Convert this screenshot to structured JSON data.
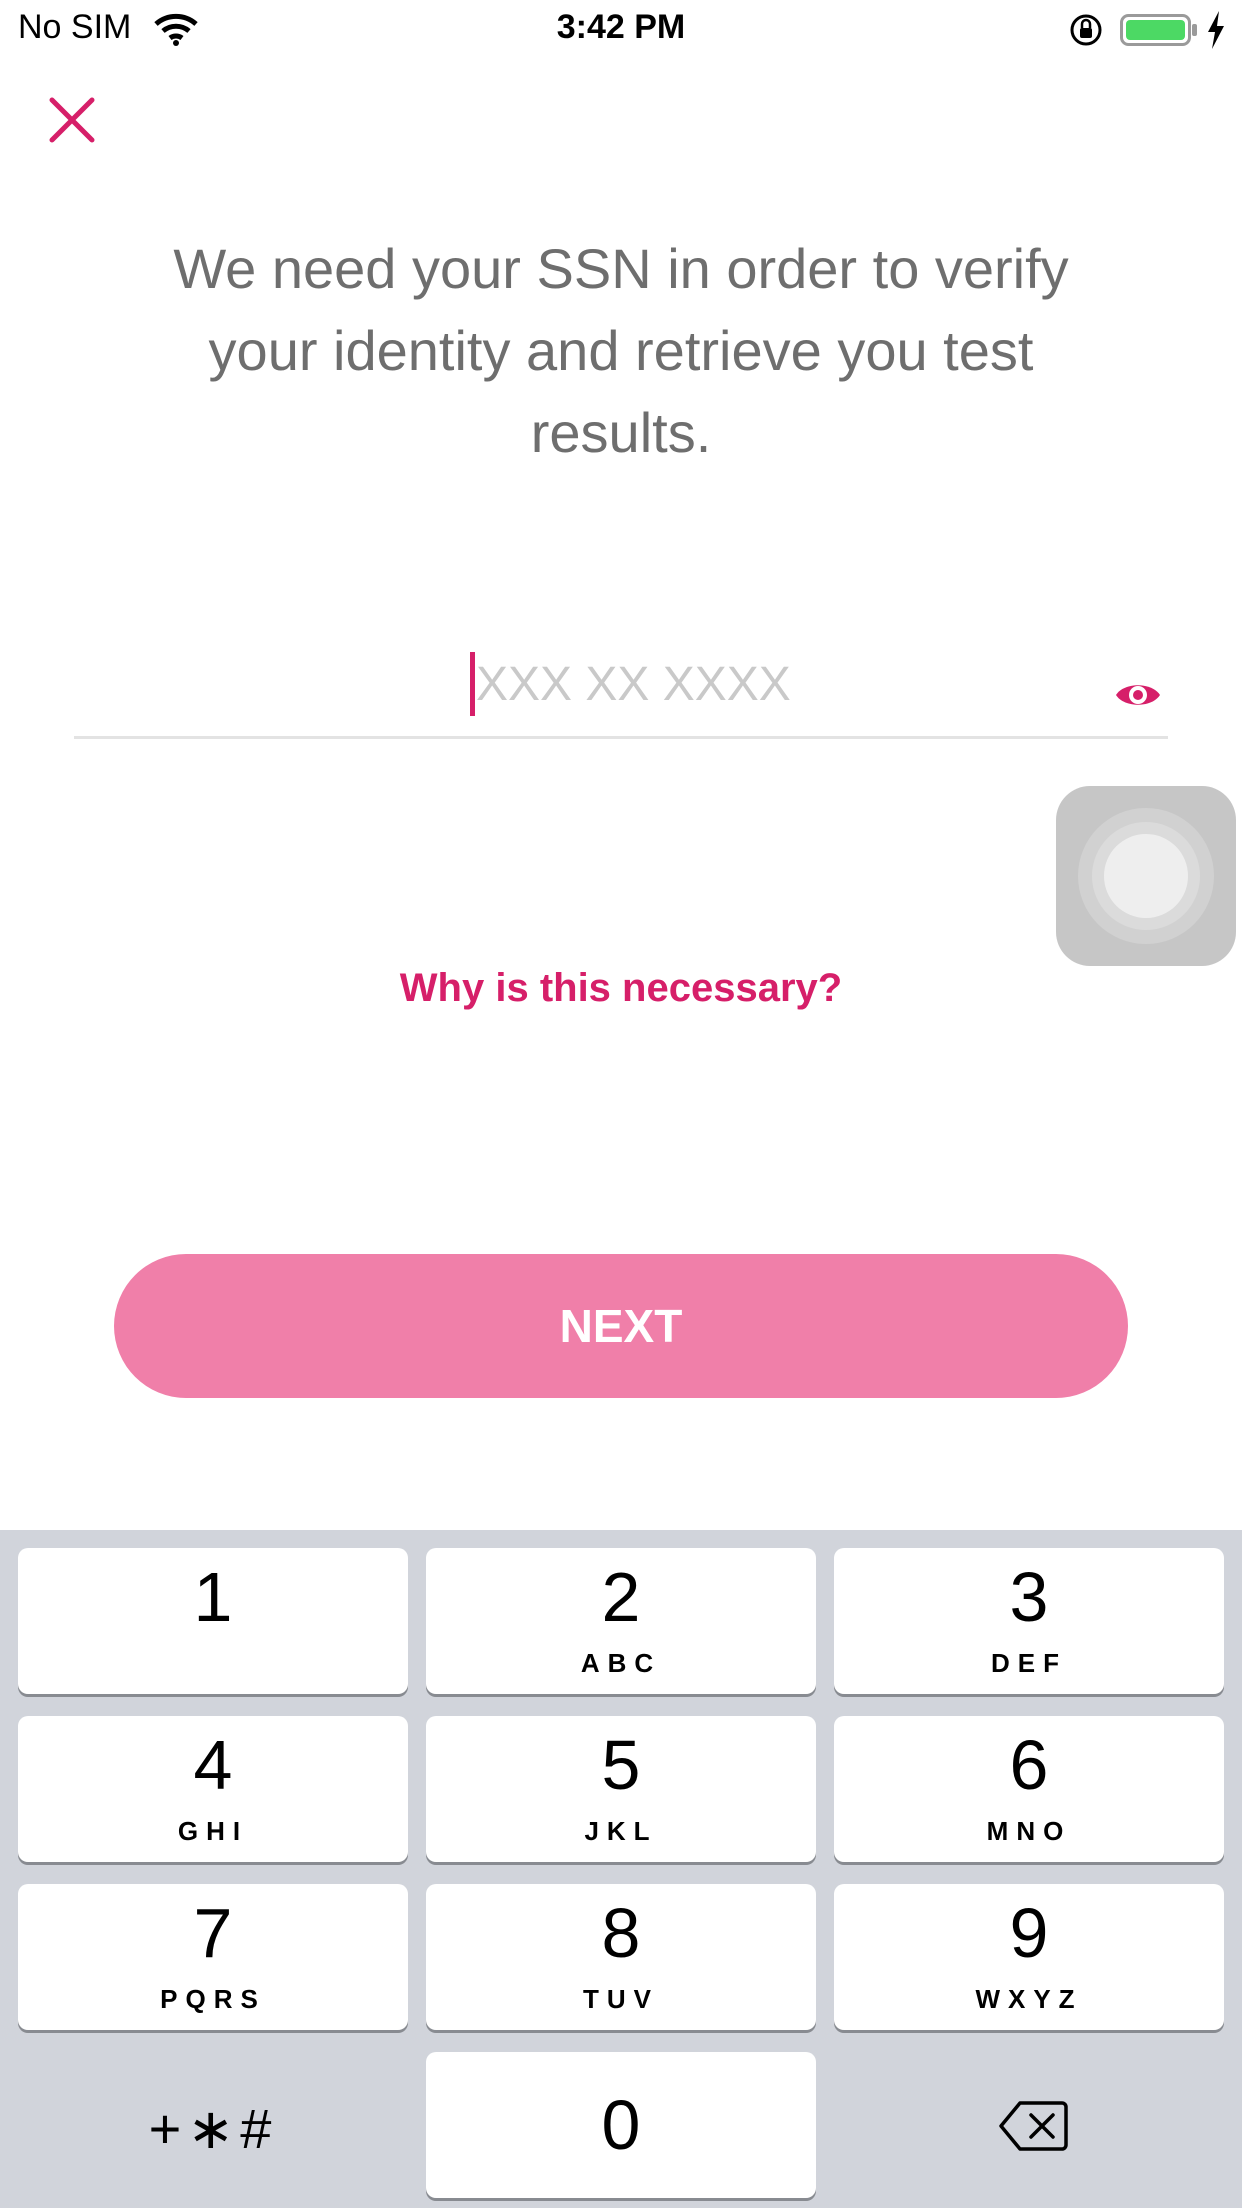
{
  "status_bar": {
    "carrier": "No SIM",
    "time": "3:42 PM",
    "battery_color": "#4cd964"
  },
  "screen": {
    "close_icon": "close-icon",
    "intro_text": "We need your SSN in order to verify your identity and retrieve you test results.",
    "ssn_field": {
      "placeholder": "XXX XX XXXX",
      "value": ""
    },
    "show_icon": "eye-icon",
    "why_link": "Why is this necessary?",
    "next_label": "NEXT",
    "accent_color": "#d61f69",
    "button_color": "#f07fa9"
  },
  "keypad": {
    "keys": [
      {
        "digit": "1",
        "letters": ""
      },
      {
        "digit": "2",
        "letters": "ABC"
      },
      {
        "digit": "3",
        "letters": "DEF"
      },
      {
        "digit": "4",
        "letters": "GHI"
      },
      {
        "digit": "5",
        "letters": "JKL"
      },
      {
        "digit": "6",
        "letters": "MNO"
      },
      {
        "digit": "7",
        "letters": "PQRS"
      },
      {
        "digit": "8",
        "letters": "TUV"
      },
      {
        "digit": "9",
        "letters": "WXYZ"
      },
      {
        "digit": "0",
        "letters": ""
      }
    ],
    "symbols_label": "+∗#",
    "delete_icon": "backspace-icon"
  }
}
